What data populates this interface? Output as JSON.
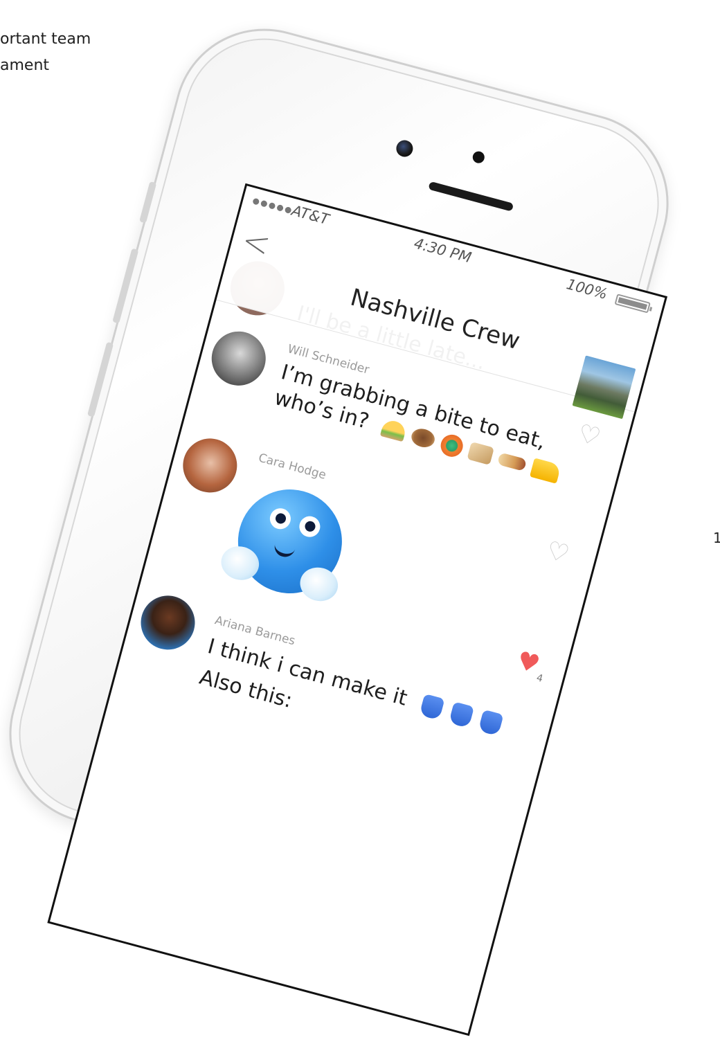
{
  "background_text": {
    "line1": "ortant team",
    "line2": "ament",
    "side_number": "1"
  },
  "status_bar": {
    "carrier": "AT&T",
    "time": "4:30 PM",
    "battery": "100%"
  },
  "nav": {
    "back_label": "<",
    "title": "Nashville Crew"
  },
  "messages": [
    {
      "partial_text": "I'll be a little late..."
    },
    {
      "sender": "Will Schneider",
      "line1": "I’m grabbing a bite to eat,",
      "line2": "who’s in?",
      "emojis": [
        "taco",
        "cookie",
        "orange",
        "toast",
        "burrito",
        "cheese"
      ]
    },
    {
      "sender": "Cara Hodge",
      "sticker": "blue-smiley-sticker",
      "likes": "4"
    },
    {
      "sender": "Ariana Barnes",
      "line1": "I think i can make it",
      "line2": "Also this:"
    }
  ],
  "colors": {
    "liked_heart": "#f05a5a",
    "empty_heart": "#cfcfcf"
  }
}
